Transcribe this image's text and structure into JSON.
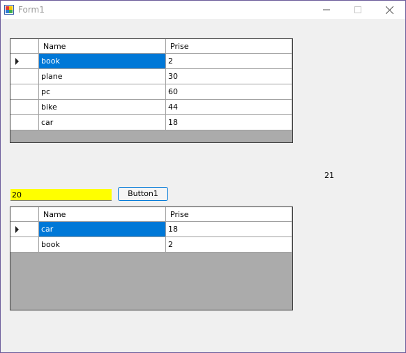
{
  "window": {
    "title": "Form1"
  },
  "grid1": {
    "columns": [
      "Name",
      "Prise"
    ],
    "rows": [
      {
        "name": "book",
        "prise": "2"
      },
      {
        "name": "plane",
        "prise": "30"
      },
      {
        "name": "pc",
        "prise": "60"
      },
      {
        "name": "bike",
        "prise": "44"
      },
      {
        "name": "car",
        "prise": "18"
      }
    ]
  },
  "grid2": {
    "columns": [
      "Name",
      "Prise"
    ],
    "rows": [
      {
        "name": "car",
        "prise": "18"
      },
      {
        "name": "book",
        "prise": "2"
      }
    ]
  },
  "textbox": {
    "value": "20",
    "background": "#ffff00"
  },
  "button1": {
    "label": "Button1"
  },
  "label1": {
    "text": "21"
  },
  "colors": {
    "selection": "#0078d7",
    "grid_background": "#ababab"
  }
}
